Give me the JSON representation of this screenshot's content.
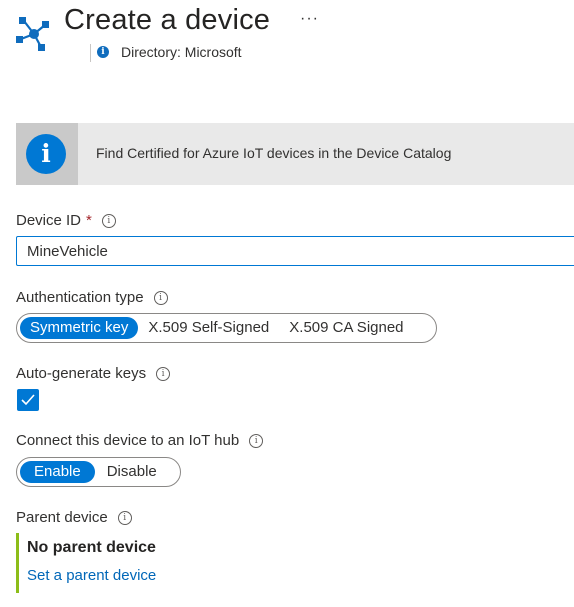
{
  "header": {
    "title": "Create a device",
    "more_label": "···",
    "directory_label": "Directory: Microsoft",
    "hub_icon": "iot-hub-icon",
    "directory_icon": "info-icon"
  },
  "banner": {
    "text": "Find Certified for Azure IoT devices in the Device Catalog",
    "icon": "info-icon",
    "icon_color": "#0078d4"
  },
  "device_id": {
    "label": "Device ID",
    "required_mark": "*",
    "value": "MineVehicle"
  },
  "auth_type": {
    "label": "Authentication type",
    "options": [
      "Symmetric key",
      "X.509 Self-Signed",
      "X.509 CA Signed"
    ],
    "selected": "Symmetric key"
  },
  "auto_keys": {
    "label": "Auto-generate keys",
    "checked": true
  },
  "connect": {
    "label": "Connect this device to an IoT hub",
    "options": [
      "Enable",
      "Disable"
    ],
    "selected": "Enable"
  },
  "parent": {
    "label": "Parent device",
    "value": "No parent device",
    "link": "Set a parent device"
  },
  "colors": {
    "accent": "#0078d4",
    "parent_bar": "#8cbd18",
    "required": "#a4262c"
  }
}
